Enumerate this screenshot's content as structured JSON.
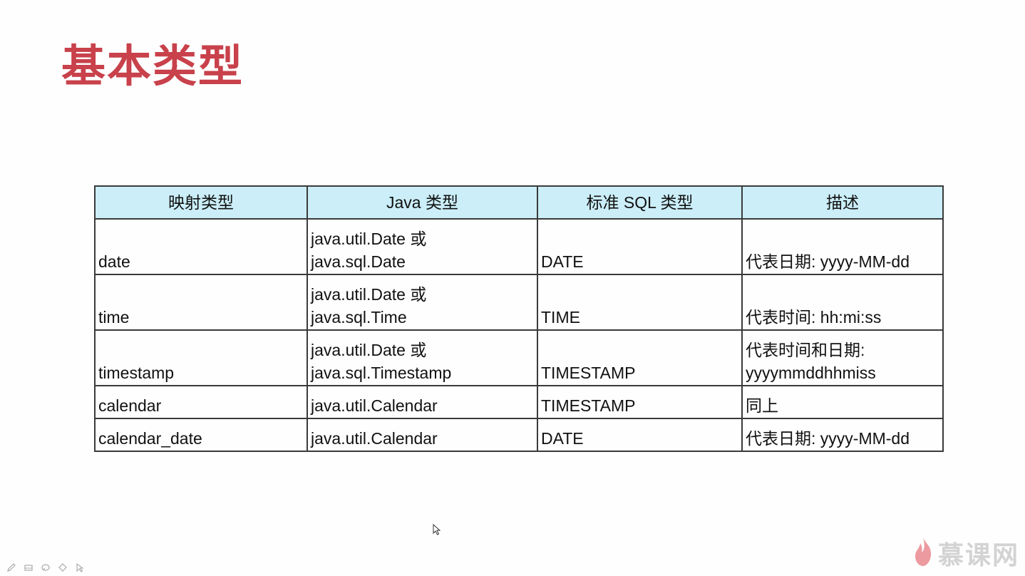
{
  "slide": {
    "title": "基本类型"
  },
  "table": {
    "headers": [
      "映射类型",
      "Java 类型",
      "标准 SQL 类型",
      "描述"
    ],
    "rows": [
      {
        "mapping": "date",
        "java": [
          "java.util.Date 或",
          "java.sql.Date"
        ],
        "sql": "DATE",
        "desc": [
          "代表日期: yyyy-MM-dd"
        ]
      },
      {
        "mapping": "time",
        "java": [
          "java.util.Date 或",
          "java.sql.Time"
        ],
        "sql": "TIME",
        "desc": [
          "代表时间: hh:mi:ss"
        ]
      },
      {
        "mapping": "timestamp",
        "java": [
          "java.util.Date 或",
          "java.sql.Timestamp"
        ],
        "sql": "TIMESTAMP",
        "desc": [
          "代表时间和日期:",
          "yyyymmddhhmiss"
        ]
      },
      {
        "mapping": "calendar",
        "java": [
          "java.util.Calendar"
        ],
        "sql": "TIMESTAMP",
        "desc": [
          "同上"
        ]
      },
      {
        "mapping": "calendar_date",
        "java": [
          "java.util.Calendar"
        ],
        "sql": "DATE",
        "desc": [
          "代表日期: yyyy-MM-dd"
        ]
      }
    ]
  },
  "toolbar": {
    "icons": [
      "pen-icon",
      "eraser-icon",
      "highlighter-icon",
      "diamond-icon",
      "pointer-icon"
    ]
  },
  "watermark": {
    "text": "慕课网"
  },
  "colors": {
    "title": "#c8414b",
    "header_bg": "#cbeef8",
    "border": "#3a3a3a"
  }
}
